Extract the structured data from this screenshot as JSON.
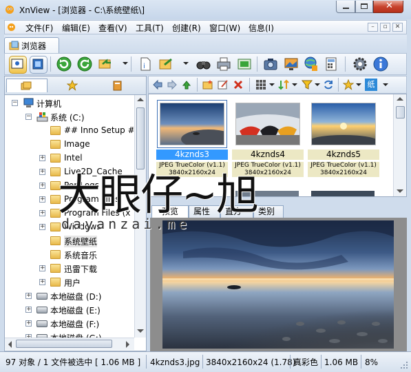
{
  "window": {
    "title": "XnView - [浏览器 - C:\\系统壁纸\\]"
  },
  "menu": {
    "items": [
      "文件(F)",
      "编辑(E)",
      "查看(V)",
      "工具(T)",
      "创建(R)",
      "窗口(W)",
      "信息(I)"
    ]
  },
  "tabs": {
    "browser": "浏览器"
  },
  "tree": {
    "items": [
      {
        "label": "计算机",
        "level": 0
      },
      {
        "label": "系统 (C:)",
        "level": 1
      },
      {
        "label": "## Inno Setup #",
        "level": 2
      },
      {
        "label": "Image",
        "level": 2
      },
      {
        "label": "Intel",
        "level": 2
      },
      {
        "label": "Live2D_Cache",
        "level": 2
      },
      {
        "label": "PerfLogs",
        "level": 2
      },
      {
        "label": "Program Files",
        "level": 2
      },
      {
        "label": "Program Files (x",
        "level": 2
      },
      {
        "label": "Windows",
        "level": 2
      },
      {
        "label": "系统壁纸",
        "level": 2
      },
      {
        "label": "系统音乐",
        "level": 2
      },
      {
        "label": "迅雷下载",
        "level": 2
      },
      {
        "label": "用户",
        "level": 2
      },
      {
        "label": "本地磁盘 (D:)",
        "level": 1
      },
      {
        "label": "本地磁盘 (E:)",
        "level": 1
      },
      {
        "label": "本地磁盘 (F:)",
        "level": 1
      },
      {
        "label": "本地磁盘 (G:)",
        "level": 1
      }
    ]
  },
  "thumbnails": [
    {
      "name": "4kznds3",
      "format": "JPEG TrueColor (v1.1)",
      "size": "3840x2160x24",
      "selected": true
    },
    {
      "name": "4kznds4",
      "format": "JPEG TrueColor (v1.1)",
      "size": "3840x2160x24",
      "selected": false
    },
    {
      "name": "4kznds5",
      "format": "JPEG TrueColor (v1.1)",
      "size": "3840x2160x24",
      "selected": false
    }
  ],
  "preview_tabs": [
    "预览",
    "属性",
    "直方图",
    "类别"
  ],
  "status": {
    "objects": "97 对象 / 1 文件被选中 [ 1.06 MB ]",
    "filename": "4kznds3.jpg",
    "dimensions": "3840x2160x24 (1.78)",
    "color": "真彩色",
    "filesize": "1.06 MB",
    "zoom": "8%"
  },
  "watermark": {
    "main": "大眼仔~旭",
    "sub": "dayanzai.me"
  },
  "colors": {
    "selection": "#3399ff",
    "thumb_label_bg": "#ece8c4",
    "frame": "#cfdcec"
  }
}
